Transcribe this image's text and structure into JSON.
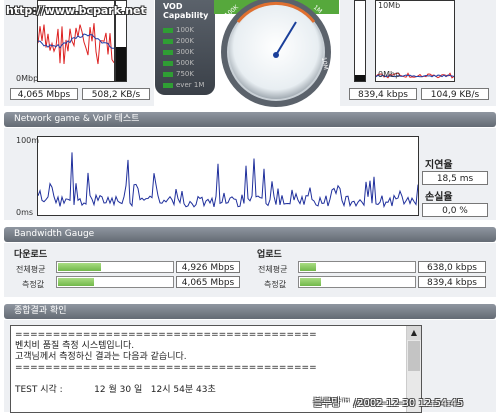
{
  "watermark_top": "http://www.bcpark.net",
  "top_left": {
    "y_top": "",
    "y_bottom": "0Mbp",
    "value_mbps": "4,065 Mbps",
    "value_kbs": "508,2 KB/s"
  },
  "vod": {
    "title1": "VOD",
    "title2": "Capability",
    "items": [
      "100K",
      "300K",
      "500K",
      "750K",
      "ever 1M"
    ],
    "items_top": [
      "100K",
      "200K",
      "300K",
      "500K",
      "750K",
      "ever 1M"
    ]
  },
  "dial": {
    "ticks": [
      "100K",
      "1M",
      "10M",
      "100M"
    ]
  },
  "top_right": {
    "y_top": "10Mb",
    "y_bottom": "0Mbp",
    "value_kbps": "839,4 kbps",
    "value_kbs": "104,9 KB/s"
  },
  "network": {
    "header": "Network game & VoIP 테스트",
    "y_top": "100m",
    "y_bottom": "0ms",
    "latency_label": "지연율",
    "latency_value": "18,5 ms",
    "loss_label": "손실율",
    "loss_value": "0,0 %"
  },
  "bandwidth": {
    "header": "Bandwidth Gauge",
    "download_label": "다운로드",
    "upload_label": "업로드",
    "avg_label": "전체평균",
    "measured_label": "측정값",
    "download_avg": "4,926 Mbps",
    "download_measured": "4,065 Mbps",
    "upload_avg": "638,0 kbps",
    "upload_measured": "839,4 kbps",
    "download_avg_fill": 0.38,
    "download_measured_fill": 0.32,
    "upload_avg_fill": 0.14,
    "upload_measured_fill": 0.18
  },
  "result": {
    "header": "종합결과 확인",
    "lines": [
      "========================================",
      "벤치비 품질 측정 시스템입니다.",
      "고객님께서 측정하신 결과는 다음과 같습니다.",
      "========================================",
      "",
      "TEST 시각 :           12 월 30 일   12시 54분 43초"
    ]
  },
  "watermark_bottom": "블루망™ /2002-12-30 12:54:45"
}
